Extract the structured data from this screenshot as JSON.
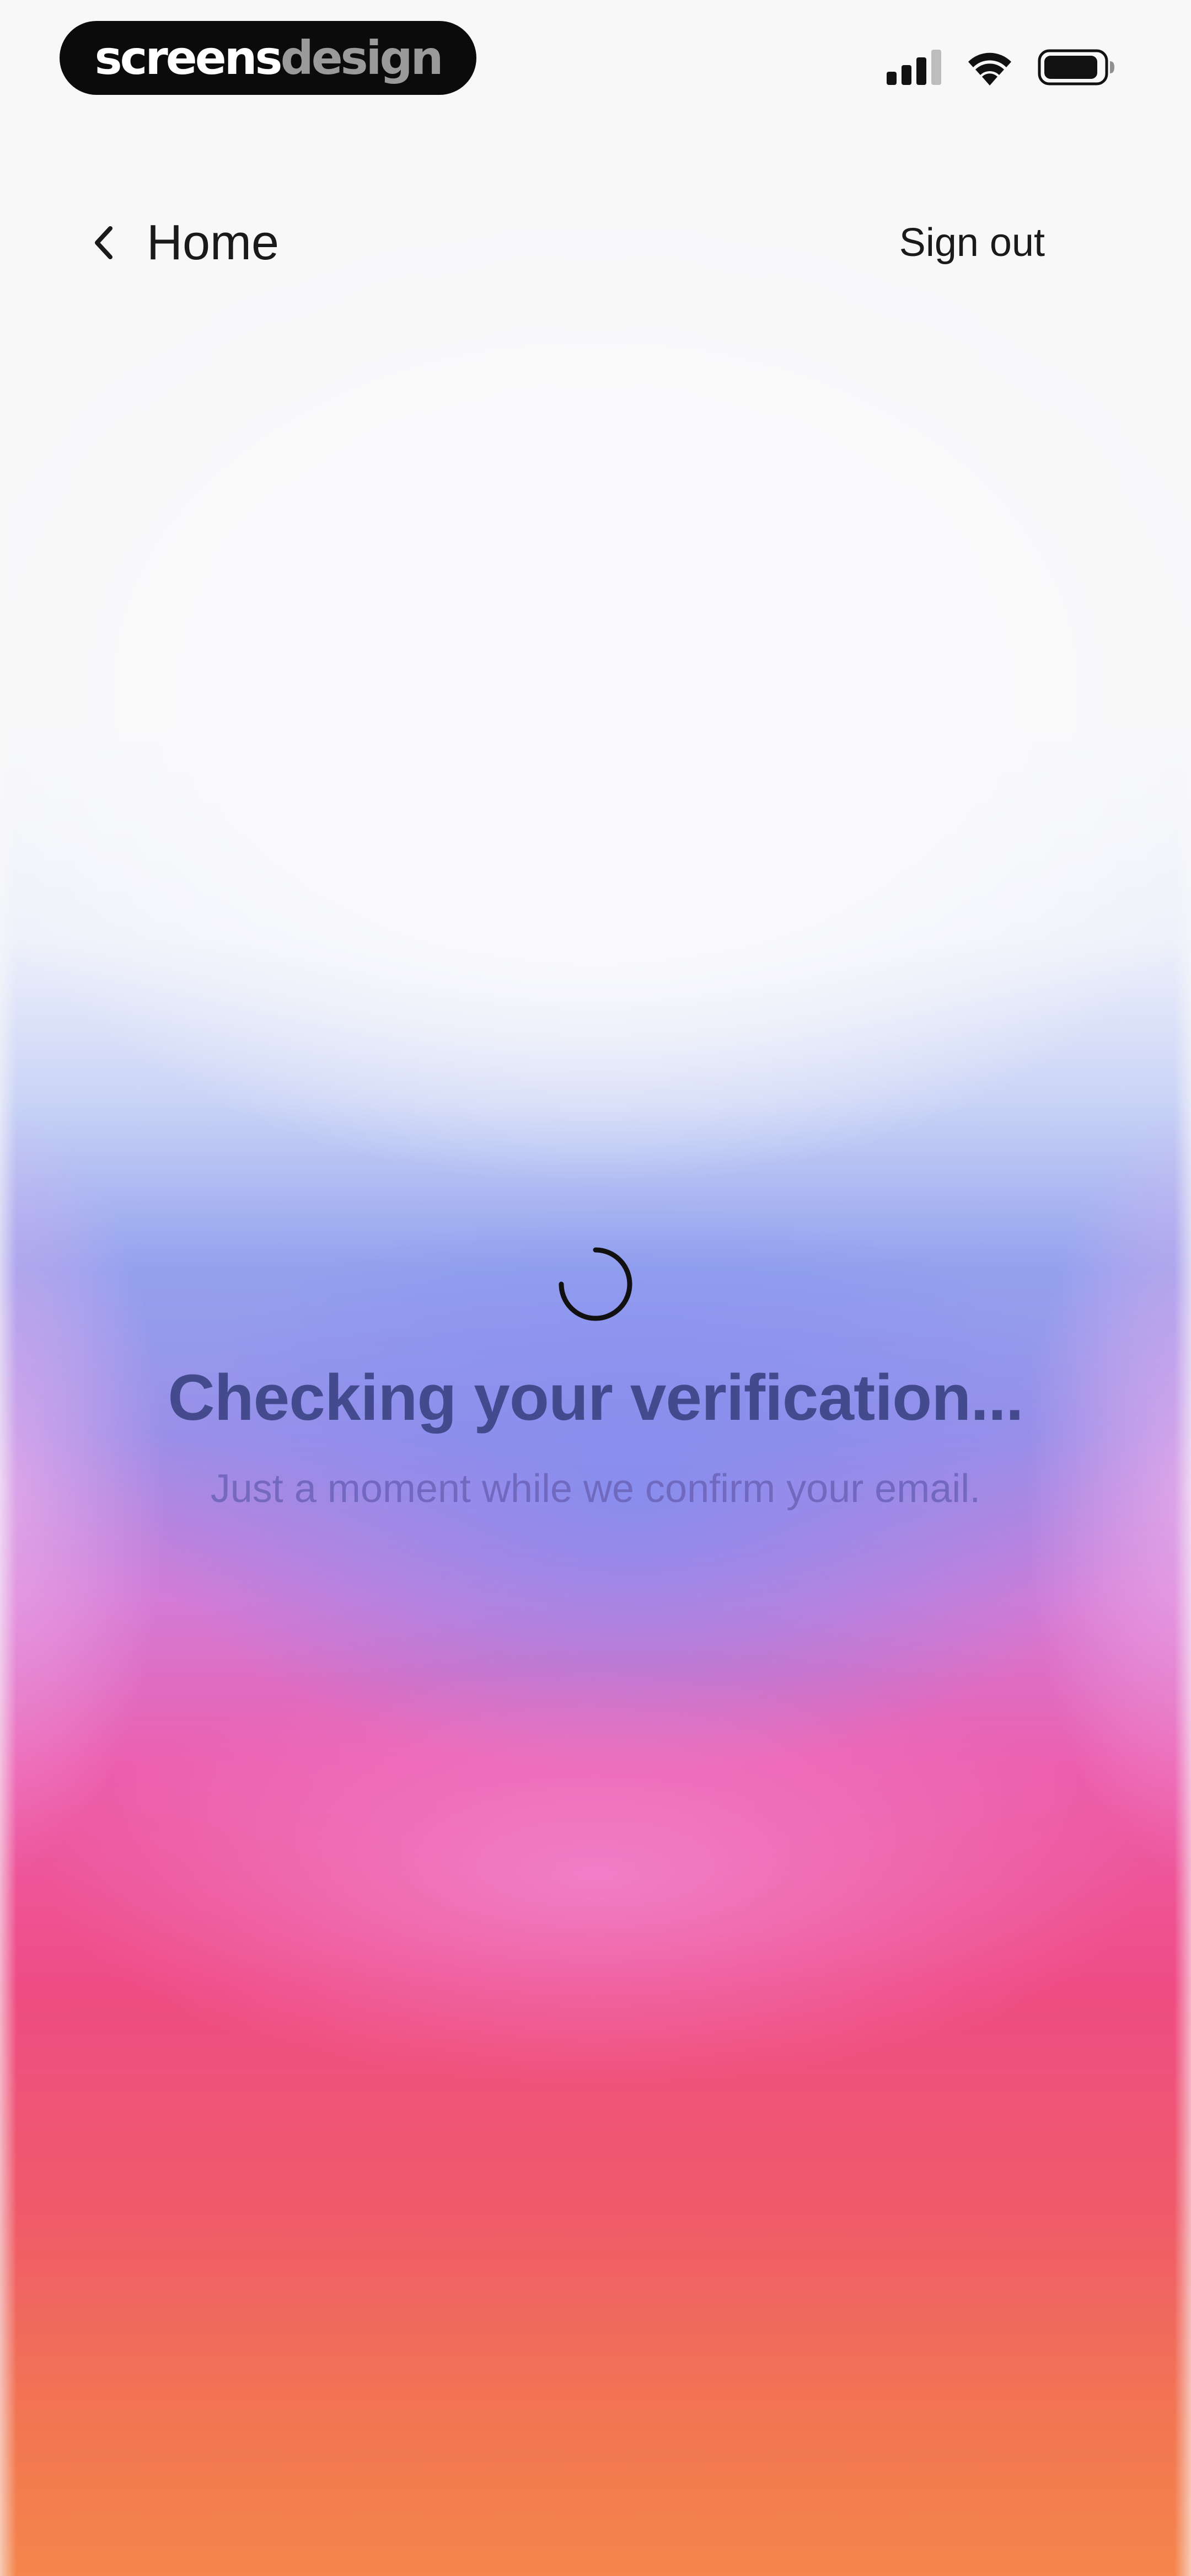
{
  "status_bar": {
    "brand_part1": "screens",
    "brand_part2": "design",
    "icons": [
      "signal-icon",
      "wifi-icon",
      "battery-icon"
    ]
  },
  "nav": {
    "back_icon": "chevron-left-icon",
    "back_label": "Home",
    "sign_out_label": "Sign out"
  },
  "main": {
    "spinner_icon": "loading-spinner-icon",
    "title": "Checking your verification...",
    "subtitle": "Just a moment while we confirm your email."
  },
  "colors": {
    "background_top": "#f8f8f9",
    "gradient_blue": "#93a1ee",
    "gradient_pink": "#ec5fae",
    "gradient_orange": "#f5854b",
    "title_color": "#3c4384",
    "subtitle_color": "#6c63b9",
    "brand_pill": "#0b0b0b"
  }
}
